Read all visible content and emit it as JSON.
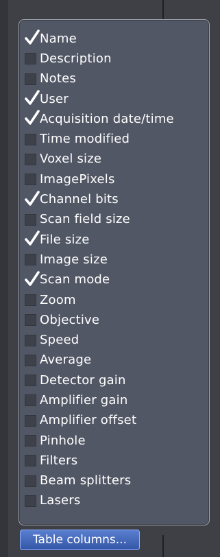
{
  "panel": {
    "items": [
      {
        "label": "Name",
        "checked": true
      },
      {
        "label": "Description",
        "checked": false
      },
      {
        "label": "Notes",
        "checked": false
      },
      {
        "label": "User",
        "checked": true
      },
      {
        "label": "Acquisition date/time",
        "checked": true
      },
      {
        "label": "Time modified",
        "checked": false
      },
      {
        "label": "Voxel size",
        "checked": false
      },
      {
        "label": "ImagePixels",
        "checked": false
      },
      {
        "label": "Channel bits",
        "checked": true
      },
      {
        "label": "Scan field size",
        "checked": false
      },
      {
        "label": "File size",
        "checked": true
      },
      {
        "label": "Image size",
        "checked": false
      },
      {
        "label": "Scan mode",
        "checked": true
      },
      {
        "label": "Zoom",
        "checked": false
      },
      {
        "label": "Objective",
        "checked": false
      },
      {
        "label": "Speed",
        "checked": false
      },
      {
        "label": "Average",
        "checked": false
      },
      {
        "label": "Detector gain",
        "checked": false
      },
      {
        "label": "Amplifier gain",
        "checked": false
      },
      {
        "label": "Amplifier offset",
        "checked": false
      },
      {
        "label": "Pinhole",
        "checked": false
      },
      {
        "label": "Filters",
        "checked": false
      },
      {
        "label": "Beam splitters",
        "checked": false
      },
      {
        "label": "Lasers",
        "checked": false
      }
    ]
  },
  "footer": {
    "button_label": "Table columns..."
  },
  "icons": {
    "checkmark": "checkmark-icon"
  },
  "colors": {
    "panel_bg": "#525765",
    "button_bg": "#3456a6",
    "text": "#ffffff"
  }
}
